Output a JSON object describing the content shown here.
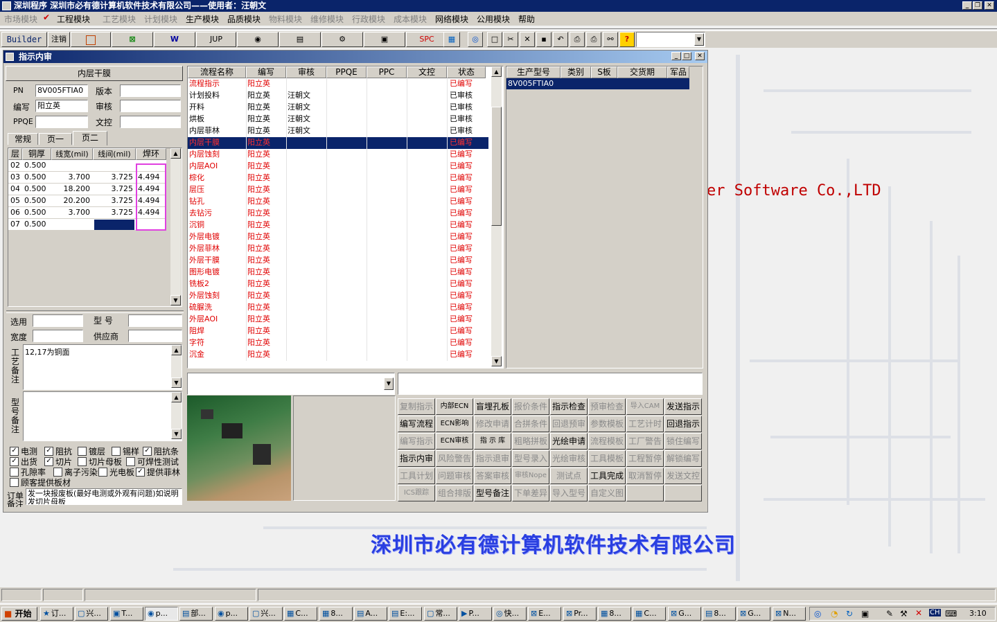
{
  "app_title": "深圳程序    深圳市必有德计算机软件技术有限公司——使用者：汪朝文",
  "menus": [
    {
      "label": "市场模块",
      "enabled": false
    },
    {
      "label": "工程模块",
      "enabled": true
    },
    {
      "label": "工艺模块",
      "enabled": false
    },
    {
      "label": "计划模块",
      "enabled": false
    },
    {
      "label": "生产模块",
      "enabled": true
    },
    {
      "label": "品质模块",
      "enabled": true
    },
    {
      "label": "物料模块",
      "enabled": false
    },
    {
      "label": "维修模块",
      "enabled": false
    },
    {
      "label": "行政模块",
      "enabled": false
    },
    {
      "label": "成本模块",
      "enabled": false
    },
    {
      "label": "网络模块",
      "enabled": true
    },
    {
      "label": "公用模块",
      "enabled": true
    },
    {
      "label": "帮助",
      "enabled": true
    }
  ],
  "toolbar": {
    "builder": "Builder",
    "logout": "注销",
    "jup": "JUP",
    "spc": "SPC"
  },
  "window": {
    "title": "指示内审"
  },
  "left": {
    "section_title": "内层干膜",
    "pn_label": "PN",
    "pn_value": "8V005FTIA0",
    "version_label": "版本",
    "version_value": "",
    "author_label": "编写",
    "author_value": "阳立英",
    "review_label": "审核",
    "review_value": "",
    "ppqe_label": "PPQE",
    "ppqe_value": "",
    "wenkong_label": "文控",
    "wenkong_value": "",
    "tabs": [
      "常规",
      "页一",
      "页二"
    ],
    "layer_headers": [
      "层",
      "铜厚",
      "线宽(mil)",
      "线间(mil)",
      "焊环"
    ],
    "layer_rows": [
      [
        "02",
        "0.500",
        "",
        "",
        ""
      ],
      [
        "03",
        "0.500",
        "3.700",
        "3.725",
        "4.494"
      ],
      [
        "04",
        "0.500",
        "18.200",
        "3.725",
        "4.494"
      ],
      [
        "05",
        "0.500",
        "20.200",
        "3.725",
        "4.494"
      ],
      [
        "06",
        "0.500",
        "3.700",
        "3.725",
        "4.494"
      ],
      [
        "07",
        "0.500",
        "",
        "",
        ""
      ]
    ],
    "xuanyong_label": "选用",
    "xuanyong_value": "",
    "model_label": "型  号",
    "model_value": "",
    "width_label": "宽度",
    "width_value": "",
    "supplier_label": "供应商",
    "supplier_value": "",
    "process_note_label": "工艺备注",
    "process_note": "12,17为铜面",
    "model_note_label": "型号备注",
    "model_note": "",
    "checkboxes": [
      {
        "label": "电测",
        "checked": true
      },
      {
        "label": "阻抗",
        "checked": true
      },
      {
        "label": "镀层",
        "checked": false
      },
      {
        "label": "锡样",
        "checked": false
      },
      {
        "label": "阻抗条",
        "checked": true
      },
      {
        "label": "出货",
        "checked": true
      },
      {
        "label": "切片",
        "checked": true
      },
      {
        "label": "切片母板",
        "checked": false
      },
      {
        "label": "可焊性测试",
        "checked": false
      },
      {
        "label": "孔隙率",
        "checked": false
      },
      {
        "label": "离子污染",
        "checked": false
      },
      {
        "label": "光电板",
        "checked": false
      },
      {
        "label": "提供菲林",
        "checked": true
      },
      {
        "label": "顾客提供板材",
        "checked": false
      }
    ],
    "order_note_label": "订单备注",
    "order_note": "发一块报废板(最好电测或外观有问题)如说明发切片母板"
  },
  "flow": {
    "headers": [
      "流程名称",
      "编写",
      "审核",
      "PPQE",
      "PPC",
      "文控",
      "状态"
    ],
    "rows": [
      {
        "name": "流程指示",
        "author": "阳立英",
        "reviewer": "",
        "status": "已编写",
        "red": true
      },
      {
        "name": "计划投料",
        "author": "阳立英",
        "reviewer": "汪朝文",
        "status": "已审核",
        "red": false
      },
      {
        "name": "开料",
        "author": "阳立英",
        "reviewer": "汪朝文",
        "status": "已审核",
        "red": false
      },
      {
        "name": "烘板",
        "author": "阳立英",
        "reviewer": "汪朝文",
        "status": "已审核",
        "red": false
      },
      {
        "name": "内层菲林",
        "author": "阳立英",
        "reviewer": "汪朝文",
        "status": "已审核",
        "red": false
      },
      {
        "name": "内层干膜",
        "author": "阳立英",
        "reviewer": "",
        "status": "已编写",
        "red": true
      },
      {
        "name": "内层蚀刻",
        "author": "阳立英",
        "reviewer": "",
        "status": "已编写",
        "red": true
      },
      {
        "name": "内层AOI",
        "author": "阳立英",
        "reviewer": "",
        "status": "已编写",
        "red": true
      },
      {
        "name": "棕化",
        "author": "阳立英",
        "reviewer": "",
        "status": "已编写",
        "red": true
      },
      {
        "name": "层压",
        "author": "阳立英",
        "reviewer": "",
        "status": "已编写",
        "red": true
      },
      {
        "name": "钻孔",
        "author": "阳立英",
        "reviewer": "",
        "status": "已编写",
        "red": true
      },
      {
        "name": "去钻污",
        "author": "阳立英",
        "reviewer": "",
        "status": "已编写",
        "red": true
      },
      {
        "name": "沉铜",
        "author": "阳立英",
        "reviewer": "",
        "status": "已编写",
        "red": true
      },
      {
        "name": "外层电镀",
        "author": "阳立英",
        "reviewer": "",
        "status": "已编写",
        "red": true
      },
      {
        "name": "外层菲林",
        "author": "阳立英",
        "reviewer": "",
        "status": "已编写",
        "red": true
      },
      {
        "name": "外层干膜",
        "author": "阳立英",
        "reviewer": "",
        "status": "已编写",
        "red": true
      },
      {
        "name": "图形电镀",
        "author": "阳立英",
        "reviewer": "",
        "status": "已编写",
        "red": true
      },
      {
        "name": "铣板2",
        "author": "阳立英",
        "reviewer": "",
        "status": "已编写",
        "red": true
      },
      {
        "name": "外层蚀刻",
        "author": "阳立英",
        "reviewer": "",
        "status": "已编写",
        "red": true
      },
      {
        "name": "硫脲洗",
        "author": "阳立英",
        "reviewer": "",
        "status": "已编写",
        "red": true
      },
      {
        "name": "外层AOI",
        "author": "阳立英",
        "reviewer": "",
        "status": "已编写",
        "red": true
      },
      {
        "name": "阻焊",
        "author": "阳立英",
        "reviewer": "",
        "status": "已编写",
        "red": true
      },
      {
        "name": "字符",
        "author": "阳立英",
        "reviewer": "",
        "status": "已编写",
        "red": true
      },
      {
        "name": "沉金",
        "author": "阳立英",
        "reviewer": "",
        "status": "已编写",
        "red": true
      }
    ]
  },
  "models": {
    "headers": [
      "生产型号",
      "类别",
      "S板",
      "交货期",
      "军品"
    ],
    "rows": [
      [
        "8V005FTIA0",
        "",
        "",
        "",
        ""
      ]
    ]
  },
  "buttons": [
    [
      {
        "l": "复制指示",
        "e": false
      },
      {
        "l": "内部ECN",
        "e": true
      },
      {
        "l": "盲埋孔板",
        "e": true
      },
      {
        "l": "报价条件",
        "e": false
      },
      {
        "l": "指示检查",
        "e": true
      },
      {
        "l": "预审检查",
        "e": false
      },
      {
        "l": "导入CAM",
        "e": false
      },
      {
        "l": "发送指示",
        "e": true
      }
    ],
    [
      {
        "l": "编写流程",
        "e": true
      },
      {
        "l": "ECN影响",
        "e": true
      },
      {
        "l": "修改申请",
        "e": false
      },
      {
        "l": "合拼条件",
        "e": false
      },
      {
        "l": "回退预审",
        "e": false
      },
      {
        "l": "参数模板",
        "e": false
      },
      {
        "l": "工艺计时",
        "e": false
      },
      {
        "l": "回退指示",
        "e": true
      }
    ],
    [
      {
        "l": "编写指示",
        "e": false
      },
      {
        "l": "ECN审核",
        "e": true
      },
      {
        "l": "指 示 库",
        "e": true
      },
      {
        "l": "粗略拼板",
        "e": false
      },
      {
        "l": "光绘申请",
        "e": true
      },
      {
        "l": "流程模板",
        "e": false
      },
      {
        "l": "工厂警告",
        "e": false
      },
      {
        "l": "锁住编写",
        "e": false
      }
    ],
    [
      {
        "l": "指示内审",
        "e": true
      },
      {
        "l": "风险警告",
        "e": false
      },
      {
        "l": "指示退审",
        "e": false
      },
      {
        "l": "型号录入",
        "e": false
      },
      {
        "l": "光绘审核",
        "e": false
      },
      {
        "l": "工具模板",
        "e": false
      },
      {
        "l": "工程暂停",
        "e": false
      },
      {
        "l": "解锁编写",
        "e": false
      }
    ],
    [
      {
        "l": "工具计划",
        "e": false
      },
      {
        "l": "问题审核",
        "e": false
      },
      {
        "l": "答案审核",
        "e": false
      },
      {
        "l": "审核Nope",
        "e": false
      },
      {
        "l": "测试点",
        "e": false
      },
      {
        "l": "工具完成",
        "e": true
      },
      {
        "l": "取消暂停",
        "e": false
      },
      {
        "l": "发送文控",
        "e": false
      }
    ],
    [
      {
        "l": "ICS跟踪",
        "e": false
      },
      {
        "l": "组合排版",
        "e": false
      },
      {
        "l": "型号备注",
        "e": true
      },
      {
        "l": "下单差异",
        "e": false
      },
      {
        "l": "导入型号",
        "e": false
      },
      {
        "l": "自定义图",
        "e": false
      },
      {
        "l": "",
        "e": false
      },
      {
        "l": "",
        "e": false
      }
    ]
  ],
  "background": {
    "brand_text": "er Software Co.,LTD",
    "company_text": "深圳市必有德计算机软件技术有限公司"
  },
  "taskbar": {
    "start": "开始",
    "tasks": [
      "订...",
      "兴...",
      "T...",
      "p...",
      "部...",
      "p...",
      "兴...",
      "C...",
      "8...",
      "A...",
      "E:...",
      "常...",
      "P...",
      "快...",
      "E...",
      "Pr...",
      "8...",
      "C...",
      "G...",
      "8...",
      "G...",
      "N..."
    ],
    "clock": "3:10",
    "lang": "CH"
  },
  "colors": {
    "titlebar": "#0a246a",
    "selection": "#0a246a",
    "red_text": "#e00000",
    "highlight_box": "#e040e0",
    "company_blue": "#2a3fe0"
  }
}
